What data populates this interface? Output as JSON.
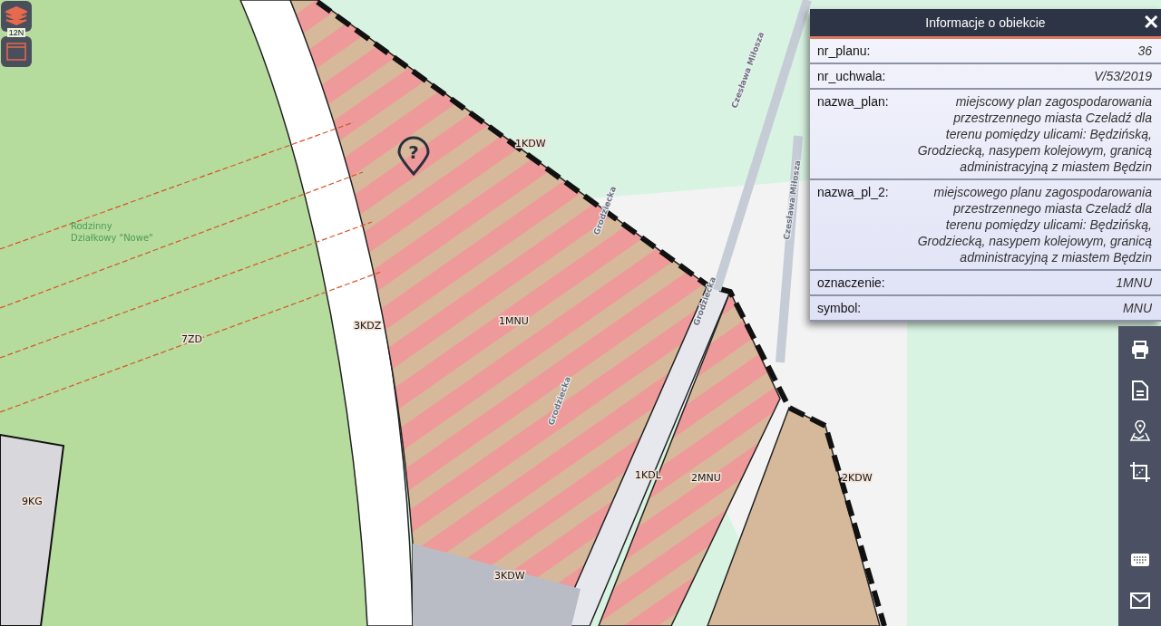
{
  "map": {
    "layer_badge": "12N",
    "zone_labels": [
      {
        "text": "7ZD"
      },
      {
        "text": "3KDZ"
      },
      {
        "text": "1MNU"
      },
      {
        "text": "1KDW"
      },
      {
        "text": "9KG"
      },
      {
        "text": "1KDL"
      },
      {
        "text": "2MNU"
      },
      {
        "text": "2KDW"
      },
      {
        "text": "3KDW"
      }
    ],
    "street_labels": [
      {
        "text": "Czesława Miłosza"
      },
      {
        "text": "Czesława Miłosza"
      },
      {
        "text": "Grodziecka"
      },
      {
        "text": "Grodziecka"
      },
      {
        "text": "Grodziecka"
      }
    ],
    "pin_symbol": "?",
    "poi_label": [
      "Rodzinny",
      "Działkowy \"Nowe\""
    ]
  },
  "info_panel": {
    "title": "Informacje o obiekcie",
    "close": "✕",
    "rows": [
      {
        "label": "nr_planu:",
        "value": "36"
      },
      {
        "label": "nr_uchwala:",
        "value": "V/53/2019"
      },
      {
        "label": "nazwa_plan:",
        "value": "miejscowy plan zagospodarowania przestrzennego miasta Czeladź dla terenu pomiędzy ulicami: Będzińską, Grodziecką, nasypem kolejowym, granicą administracyjną z miastem Będzin"
      },
      {
        "label": "nazwa_pl_2:",
        "value": "miejscowego planu zagospodarowania przestrzennego miasta Czeladź dla terenu pomiędzy ulicami: Będzińską, Grodziecką, nasypem kolejowym, granicą administracyjną z miastem Będzin"
      },
      {
        "label": "oznaczenie:",
        "value": "1MNU"
      },
      {
        "label": "symbol:",
        "value": "MNU"
      }
    ]
  },
  "toolbar": [
    {
      "kind": "print"
    },
    {
      "kind": "document"
    },
    {
      "kind": "map-pin"
    },
    {
      "kind": "crop"
    },
    {
      "kind": "keyboard"
    },
    {
      "kind": "mail"
    }
  ]
}
